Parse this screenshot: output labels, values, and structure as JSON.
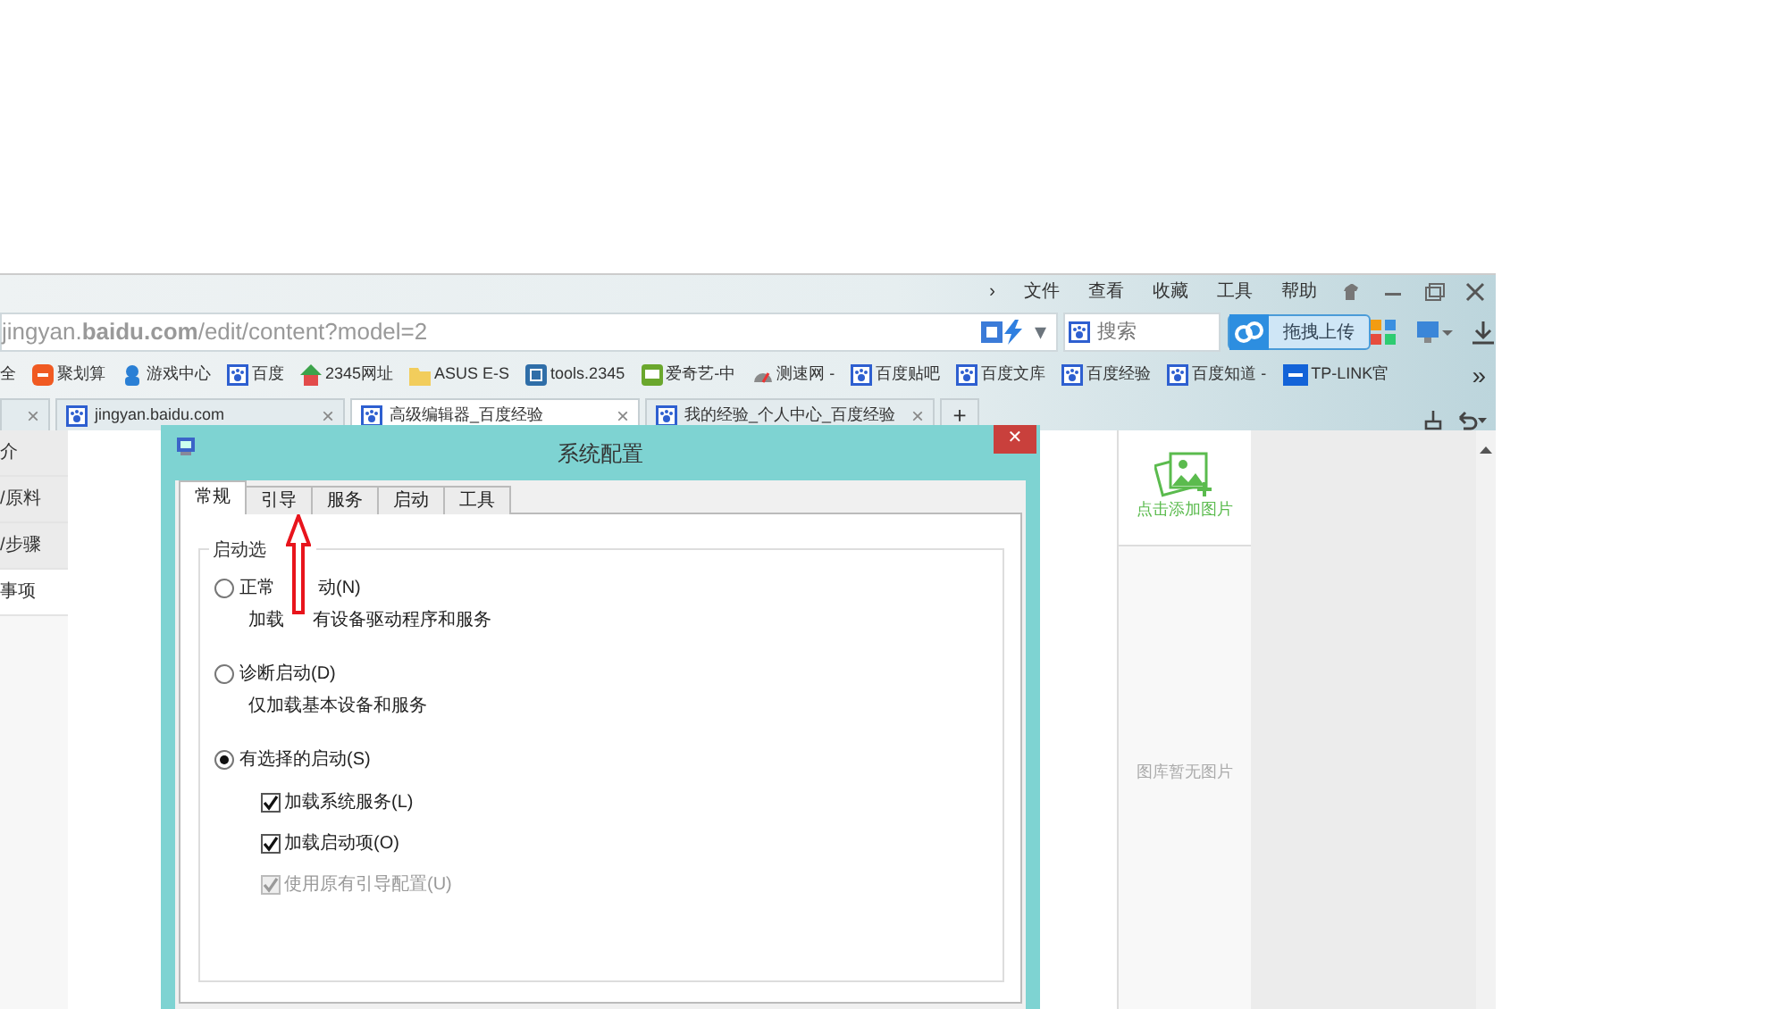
{
  "menu": {
    "chevron": "›",
    "items": [
      "文件",
      "查看",
      "收藏",
      "工具",
      "帮助"
    ]
  },
  "address_bar": {
    "url": "jingyan.**baidu.com**/edit/content?model=2",
    "dropdown": "▾"
  },
  "search": {
    "placeholder": "搜索"
  },
  "upload_button": "拖拽上传",
  "bookmarks": [
    "全",
    "聚划算",
    "游戏中心",
    "百度",
    "2345网址",
    "ASUS E-S",
    "tools.2345",
    "爱奇艺-中",
    "测速网 -",
    "百度贴吧",
    "百度文库",
    "百度经验",
    "百度知道 -",
    "TP-LINK官"
  ],
  "more_bookmarks": "»",
  "tabs": [
    {
      "close": "×",
      "selected": false
    },
    {
      "label": "jingyan.baidu.com",
      "close": "×",
      "selected": false
    },
    {
      "label": "高级编辑器_百度经验",
      "close": "×",
      "selected": true
    },
    {
      "label": "我的经验_个人中心_百度经验",
      "close": "×",
      "selected": false
    }
  ],
  "new_tab": "+",
  "sidebar": {
    "items": [
      {
        "label": "介",
        "selected": false
      },
      {
        "label": "/原料",
        "selected": false
      },
      {
        "label": "/步骤",
        "selected": false
      },
      {
        "label": "事项",
        "selected": true
      }
    ]
  },
  "image_panel": {
    "add_label": "点击添加图片",
    "empty_text": "图库暂无图片"
  },
  "dialog": {
    "title": "系统配置",
    "close": "✕",
    "tabs": [
      {
        "label": "常规",
        "selected": true
      },
      {
        "label": "引导",
        "selected": false
      },
      {
        "label": "服务",
        "selected": false
      },
      {
        "label": "启动",
        "selected": false
      },
      {
        "label": "工具",
        "selected": false
      }
    ],
    "legend": [
      "启动选"
    ],
    "options": [
      {
        "label": [
          "正常",
          "动(N)"
        ],
        "description": [
          "加载",
          "有设备驱动程序和服务"
        ],
        "selected": false
      },
      {
        "label": [
          "诊断启动(D)"
        ],
        "description": [
          "仅加载基本设备和服务"
        ],
        "selected": false
      },
      {
        "label": [
          "有选择的启动(S)"
        ],
        "selected": true
      }
    ],
    "checkboxes": [
      {
        "label": "加载系统服务(L)",
        "checked": true,
        "disabled": false
      },
      {
        "label": "加载启动项(O)",
        "checked": true,
        "disabled": false
      },
      {
        "label": "使用原有引导配置(U)",
        "checked": true,
        "disabled": true
      }
    ]
  }
}
